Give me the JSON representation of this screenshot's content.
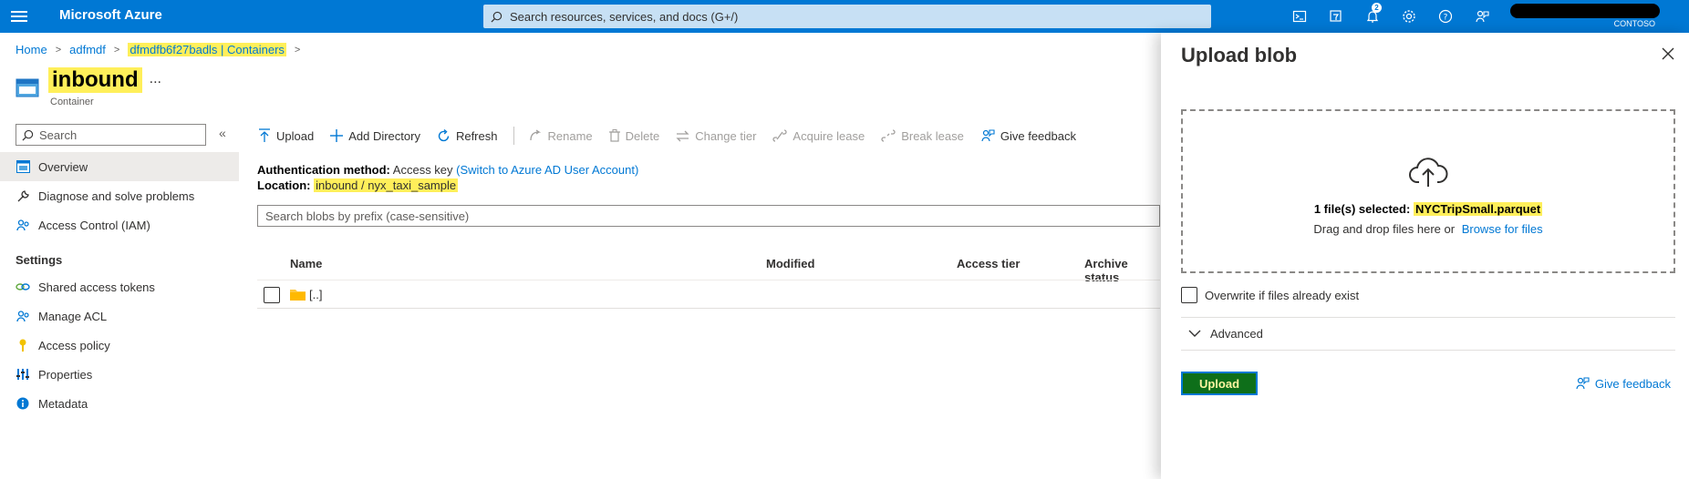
{
  "topbar": {
    "brand": "Microsoft Azure",
    "search_placeholder": "Search resources, services, and docs (G+/)",
    "notification_count": "2",
    "tenant": "CONTOSO",
    "icons": [
      "cloud-shell-icon",
      "directory-filter-icon",
      "bell-icon",
      "gear-icon",
      "help-icon",
      "feedback-icon"
    ]
  },
  "breadcrumb": [
    "Home",
    "adfmdf",
    "dfmdfb6f27badls | Containers"
  ],
  "page": {
    "title": "inbound",
    "more": "...",
    "subtitle": "Container"
  },
  "sidebar": {
    "search_placeholder": "Search",
    "items": [
      {
        "label": "Overview",
        "icon": "overview-icon"
      },
      {
        "label": "Diagnose and solve problems",
        "icon": "wrench-icon"
      },
      {
        "label": "Access Control (IAM)",
        "icon": "people-icon"
      }
    ],
    "settings_label": "Settings",
    "settings_items": [
      {
        "label": "Shared access tokens",
        "icon": "link-icon"
      },
      {
        "label": "Manage ACL",
        "icon": "people-icon"
      },
      {
        "label": "Access policy",
        "icon": "key-icon"
      },
      {
        "label": "Properties",
        "icon": "properties-icon"
      },
      {
        "label": "Metadata",
        "icon": "info-icon"
      }
    ]
  },
  "toolbar": {
    "upload": "Upload",
    "add_directory": "Add Directory",
    "refresh": "Refresh",
    "rename": "Rename",
    "delete": "Delete",
    "change_tier": "Change tier",
    "acquire_lease": "Acquire lease",
    "break_lease": "Break lease",
    "give_feedback": "Give feedback"
  },
  "info": {
    "auth_label": "Authentication method:",
    "auth_value": "Access key",
    "auth_link": "(Switch to Azure AD User Account)",
    "location_label": "Location:",
    "location_container": "inbound",
    "location_sep": "/",
    "location_folder": "nyx_taxi_sample"
  },
  "blob_search_placeholder": "Search blobs by prefix (case-sensitive)",
  "table": {
    "columns": [
      "Name",
      "Modified",
      "Access tier",
      "Archive status"
    ],
    "rows": [
      {
        "name": "[..]"
      }
    ]
  },
  "upload_panel": {
    "title": "Upload blob",
    "selected_prefix": "1 file(s) selected:",
    "selected_file": "NYCTripSmall.parquet",
    "drag_text": "Drag and drop files here",
    "or_text": "or",
    "browse_link": "Browse for files",
    "overwrite_label": "Overwrite if files already exist",
    "advanced_label": "Advanced",
    "upload_button": "Upload",
    "feedback_link": "Give feedback"
  },
  "colors": {
    "azure_blue": "#0078d4",
    "highlight": "#ffef5a",
    "upload_button_bg": "#0e6f1a"
  }
}
